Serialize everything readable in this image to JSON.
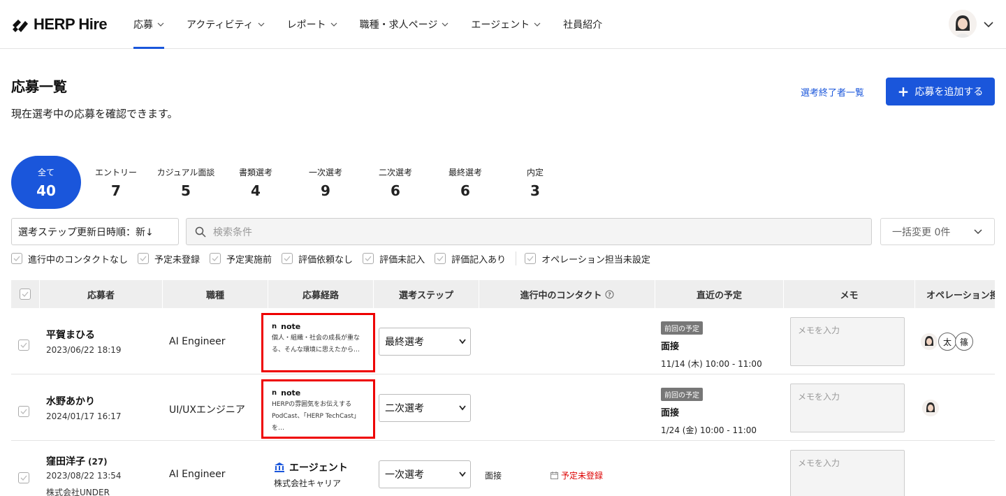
{
  "app": {
    "logo_text": "HERP Hire"
  },
  "nav": {
    "items": [
      {
        "label": "応募",
        "active": true
      },
      {
        "label": "アクティビティ"
      },
      {
        "label": "レポート"
      },
      {
        "label": "職種・求人ページ"
      },
      {
        "label": "エージェント"
      },
      {
        "label": "社員紹介"
      }
    ]
  },
  "page": {
    "title": "応募一覧",
    "description": "現在選考中の応募を確認できます。",
    "ended_link": "選考終了者一覧",
    "add_button": "応募を追加する"
  },
  "steps": [
    {
      "label": "全て",
      "count": "40",
      "active": true
    },
    {
      "label": "エントリー",
      "count": "7"
    },
    {
      "label": "カジュアル面談",
      "count": "5"
    },
    {
      "label": "書類選考",
      "count": "4"
    },
    {
      "label": "一次選考",
      "count": "9"
    },
    {
      "label": "二次選考",
      "count": "6"
    },
    {
      "label": "最終選考",
      "count": "6"
    },
    {
      "label": "内定",
      "count": "3"
    }
  ],
  "toolbar": {
    "sort_label": "選考ステップ更新日時順：新↓",
    "search_placeholder": "検索条件",
    "bulk_label": "一括変更 0件"
  },
  "filters": [
    "進行中のコンタクトなし",
    "予定未登録",
    "予定実施前",
    "評価依頼なし",
    "評価未記入",
    "評価記入あり",
    "オペレーション担当未設定"
  ],
  "table": {
    "columns": [
      "応募者",
      "職種",
      "応募経路",
      "選考ステップ",
      "進行中のコンタクト",
      "直近の予定",
      "メモ",
      "オペレーション担当"
    ],
    "memo_placeholder": "メモを入力",
    "rows": [
      {
        "name": "平賀まひる",
        "date": "2023/06/22 18:19",
        "job": "AI Engineer",
        "route_source": "note",
        "route_text": "個人・組織・社会の成長が重なる、そんな環境に思えたから…",
        "step": "最終選考",
        "schedule_badge": "前回の予定",
        "schedule_title": "面接",
        "schedule_time": "11/14 (木) 10:00 - 11:00",
        "operators": [
          "太",
          "篠"
        ]
      },
      {
        "name": "水野あかり",
        "date": "2024/01/17 16:17",
        "job": "UI/UXエンジニア",
        "route_source": "note",
        "route_text": "HERPの雰囲気をお伝えするPodCast、「HERP TechCast」を…",
        "step": "二次選考",
        "schedule_badge": "前回の予定",
        "schedule_title": "面接",
        "schedule_time": "1/24 (金) 10:00 - 11:00",
        "operators": []
      },
      {
        "name": "窪田洋子",
        "age": "(27)",
        "date": "2023/08/22 13:54",
        "company": "株式会社UNDER",
        "job": "AI Engineer",
        "route_source": "エージェント",
        "route_text": "株式会社キャリア",
        "step": "一次選考",
        "contact_type": "面接",
        "contact_status": "予定未登録"
      }
    ]
  },
  "colors": {
    "accent": "#1a56db",
    "highlight_border": "#e00000",
    "danger": "#dd0000"
  }
}
